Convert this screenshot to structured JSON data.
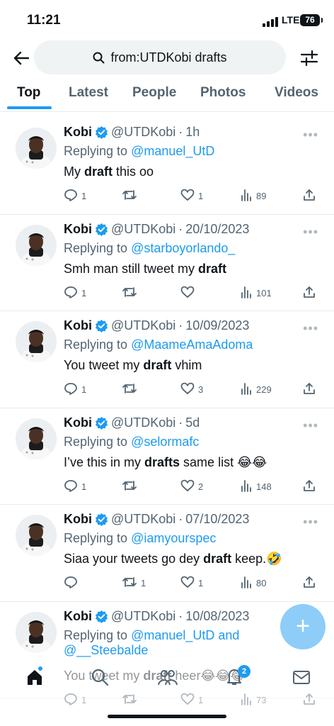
{
  "status": {
    "time": "11:21",
    "network": "LTE",
    "battery": "76"
  },
  "search": {
    "query": "from:UTDKobi drafts"
  },
  "tabs": [
    "Top",
    "Latest",
    "People",
    "Photos",
    "Videos"
  ],
  "tweets": [
    {
      "name": "Kobi",
      "handle": "@UTDKobi",
      "date": "1h",
      "reply_prefix": "Replying to ",
      "reply_to": "@manuel_UtD",
      "reply_extra": "",
      "text_before": "My ",
      "bold": "draft",
      "text_after": " this oo",
      "replies": "1",
      "retweets": "",
      "likes": "1",
      "views": "89"
    },
    {
      "name": "Kobi",
      "handle": "@UTDKobi",
      "date": "20/10/2023",
      "reply_prefix": "Replying to ",
      "reply_to": "@starboyorlando_",
      "reply_extra": "",
      "text_before": "Smh man still tweet my ",
      "bold": "draft",
      "text_after": "",
      "replies": "1",
      "retweets": "",
      "likes": "",
      "views": "101"
    },
    {
      "name": "Kobi",
      "handle": "@UTDKobi",
      "date": "10/09/2023",
      "reply_prefix": "Replying to ",
      "reply_to": "@MaameAmaAdoma",
      "reply_extra": "",
      "text_before": "You tweet my ",
      "bold": "draft",
      "text_after": " vhim",
      "replies": "1",
      "retweets": "",
      "likes": "3",
      "views": "229"
    },
    {
      "name": "Kobi",
      "handle": "@UTDKobi",
      "date": "5d",
      "reply_prefix": "Replying to ",
      "reply_to": "@selormafc",
      "reply_extra": "",
      "text_before": "I’ve this in my ",
      "bold": "drafts",
      "text_after": " same list 😂😂",
      "replies": "1",
      "retweets": "",
      "likes": "2",
      "views": "148"
    },
    {
      "name": "Kobi",
      "handle": "@UTDKobi",
      "date": "07/10/2023",
      "reply_prefix": "Replying to ",
      "reply_to": "@iamyourspec",
      "reply_extra": "",
      "text_before": "Siaa your tweets go dey ",
      "bold": "draft",
      "text_after": " keep.🤣",
      "replies": "",
      "retweets": "1",
      "likes": "1",
      "views": "80"
    },
    {
      "name": "Kobi",
      "handle": "@UTDKobi",
      "date": "10/08/2023",
      "reply_prefix": "Replying to ",
      "reply_to": "@manuel_UtD and",
      "reply_extra": "@__Steebalde",
      "text_before": "You tweet my ",
      "bold": "draft",
      "text_after": " heer😂😂😂",
      "replies": "1",
      "retweets": "",
      "likes": "1",
      "views": "73"
    }
  ],
  "nav": {
    "notifications_badge": "2"
  },
  "colors": {
    "accent": "#1d9bf0",
    "text": "#0f1419",
    "muted": "#536471"
  }
}
